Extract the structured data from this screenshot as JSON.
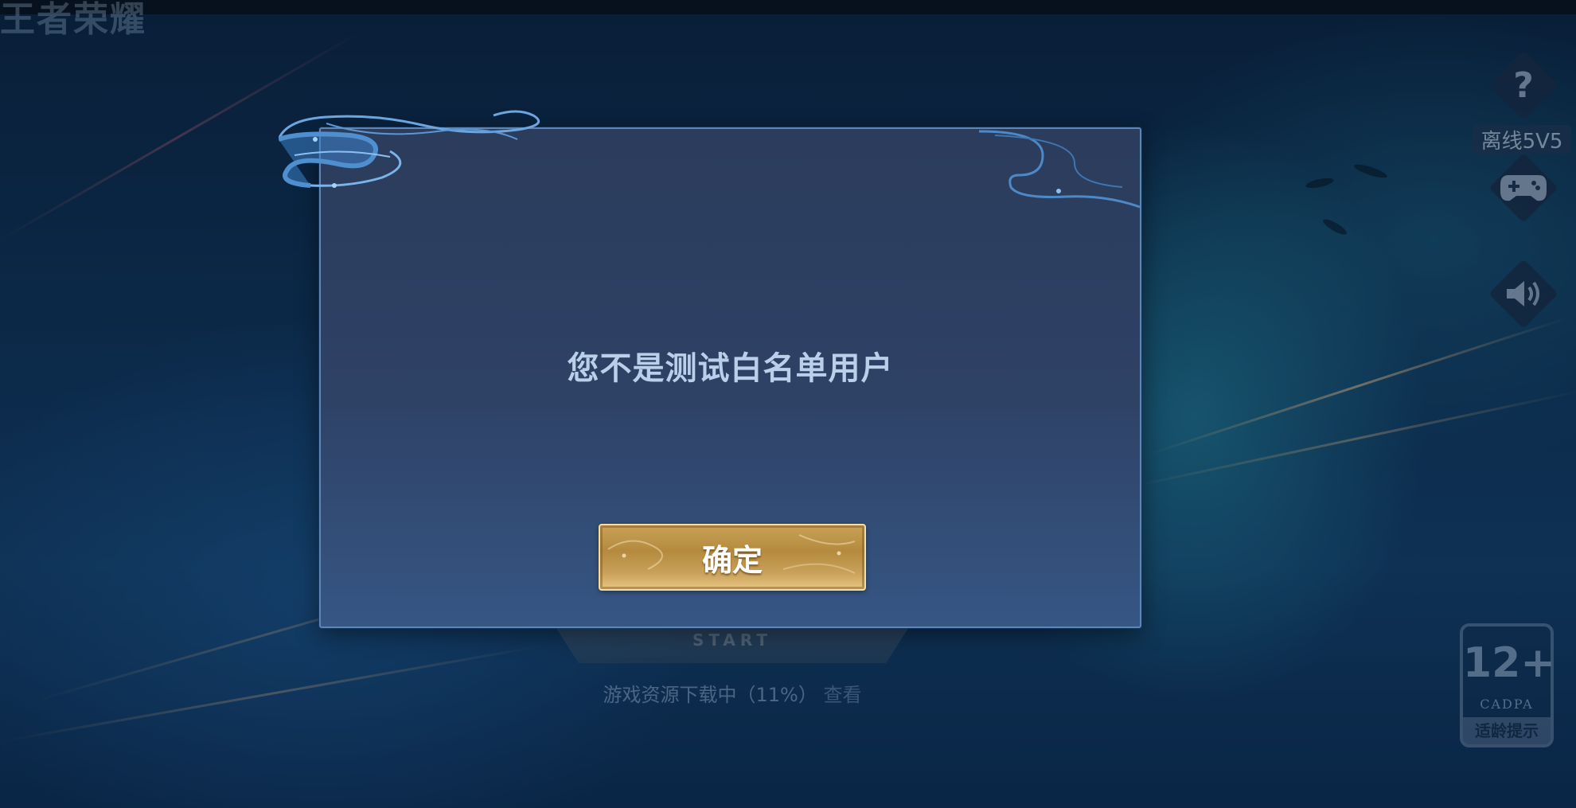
{
  "background": {
    "logo_text": "王者荣耀",
    "offline_mode_label": "离线5V5",
    "help_icon": "question-icon",
    "gamepad_icon": "gamepad-icon",
    "sound_icon": "speaker-icon",
    "start_text": "START",
    "download_status": "游戏资源下载中（11%）",
    "download_link": "查看",
    "age_rating": {
      "age": "12+",
      "org": "CADPA",
      "tip": "适龄提示"
    }
  },
  "dialog": {
    "message": "您不是测试白名单用户",
    "confirm_label": "确定"
  },
  "colors": {
    "dialog_bg": "#2e4266",
    "dialog_border": "#5a86b8",
    "message_text": "#b9cfea",
    "button_gold": "#c8a258"
  }
}
